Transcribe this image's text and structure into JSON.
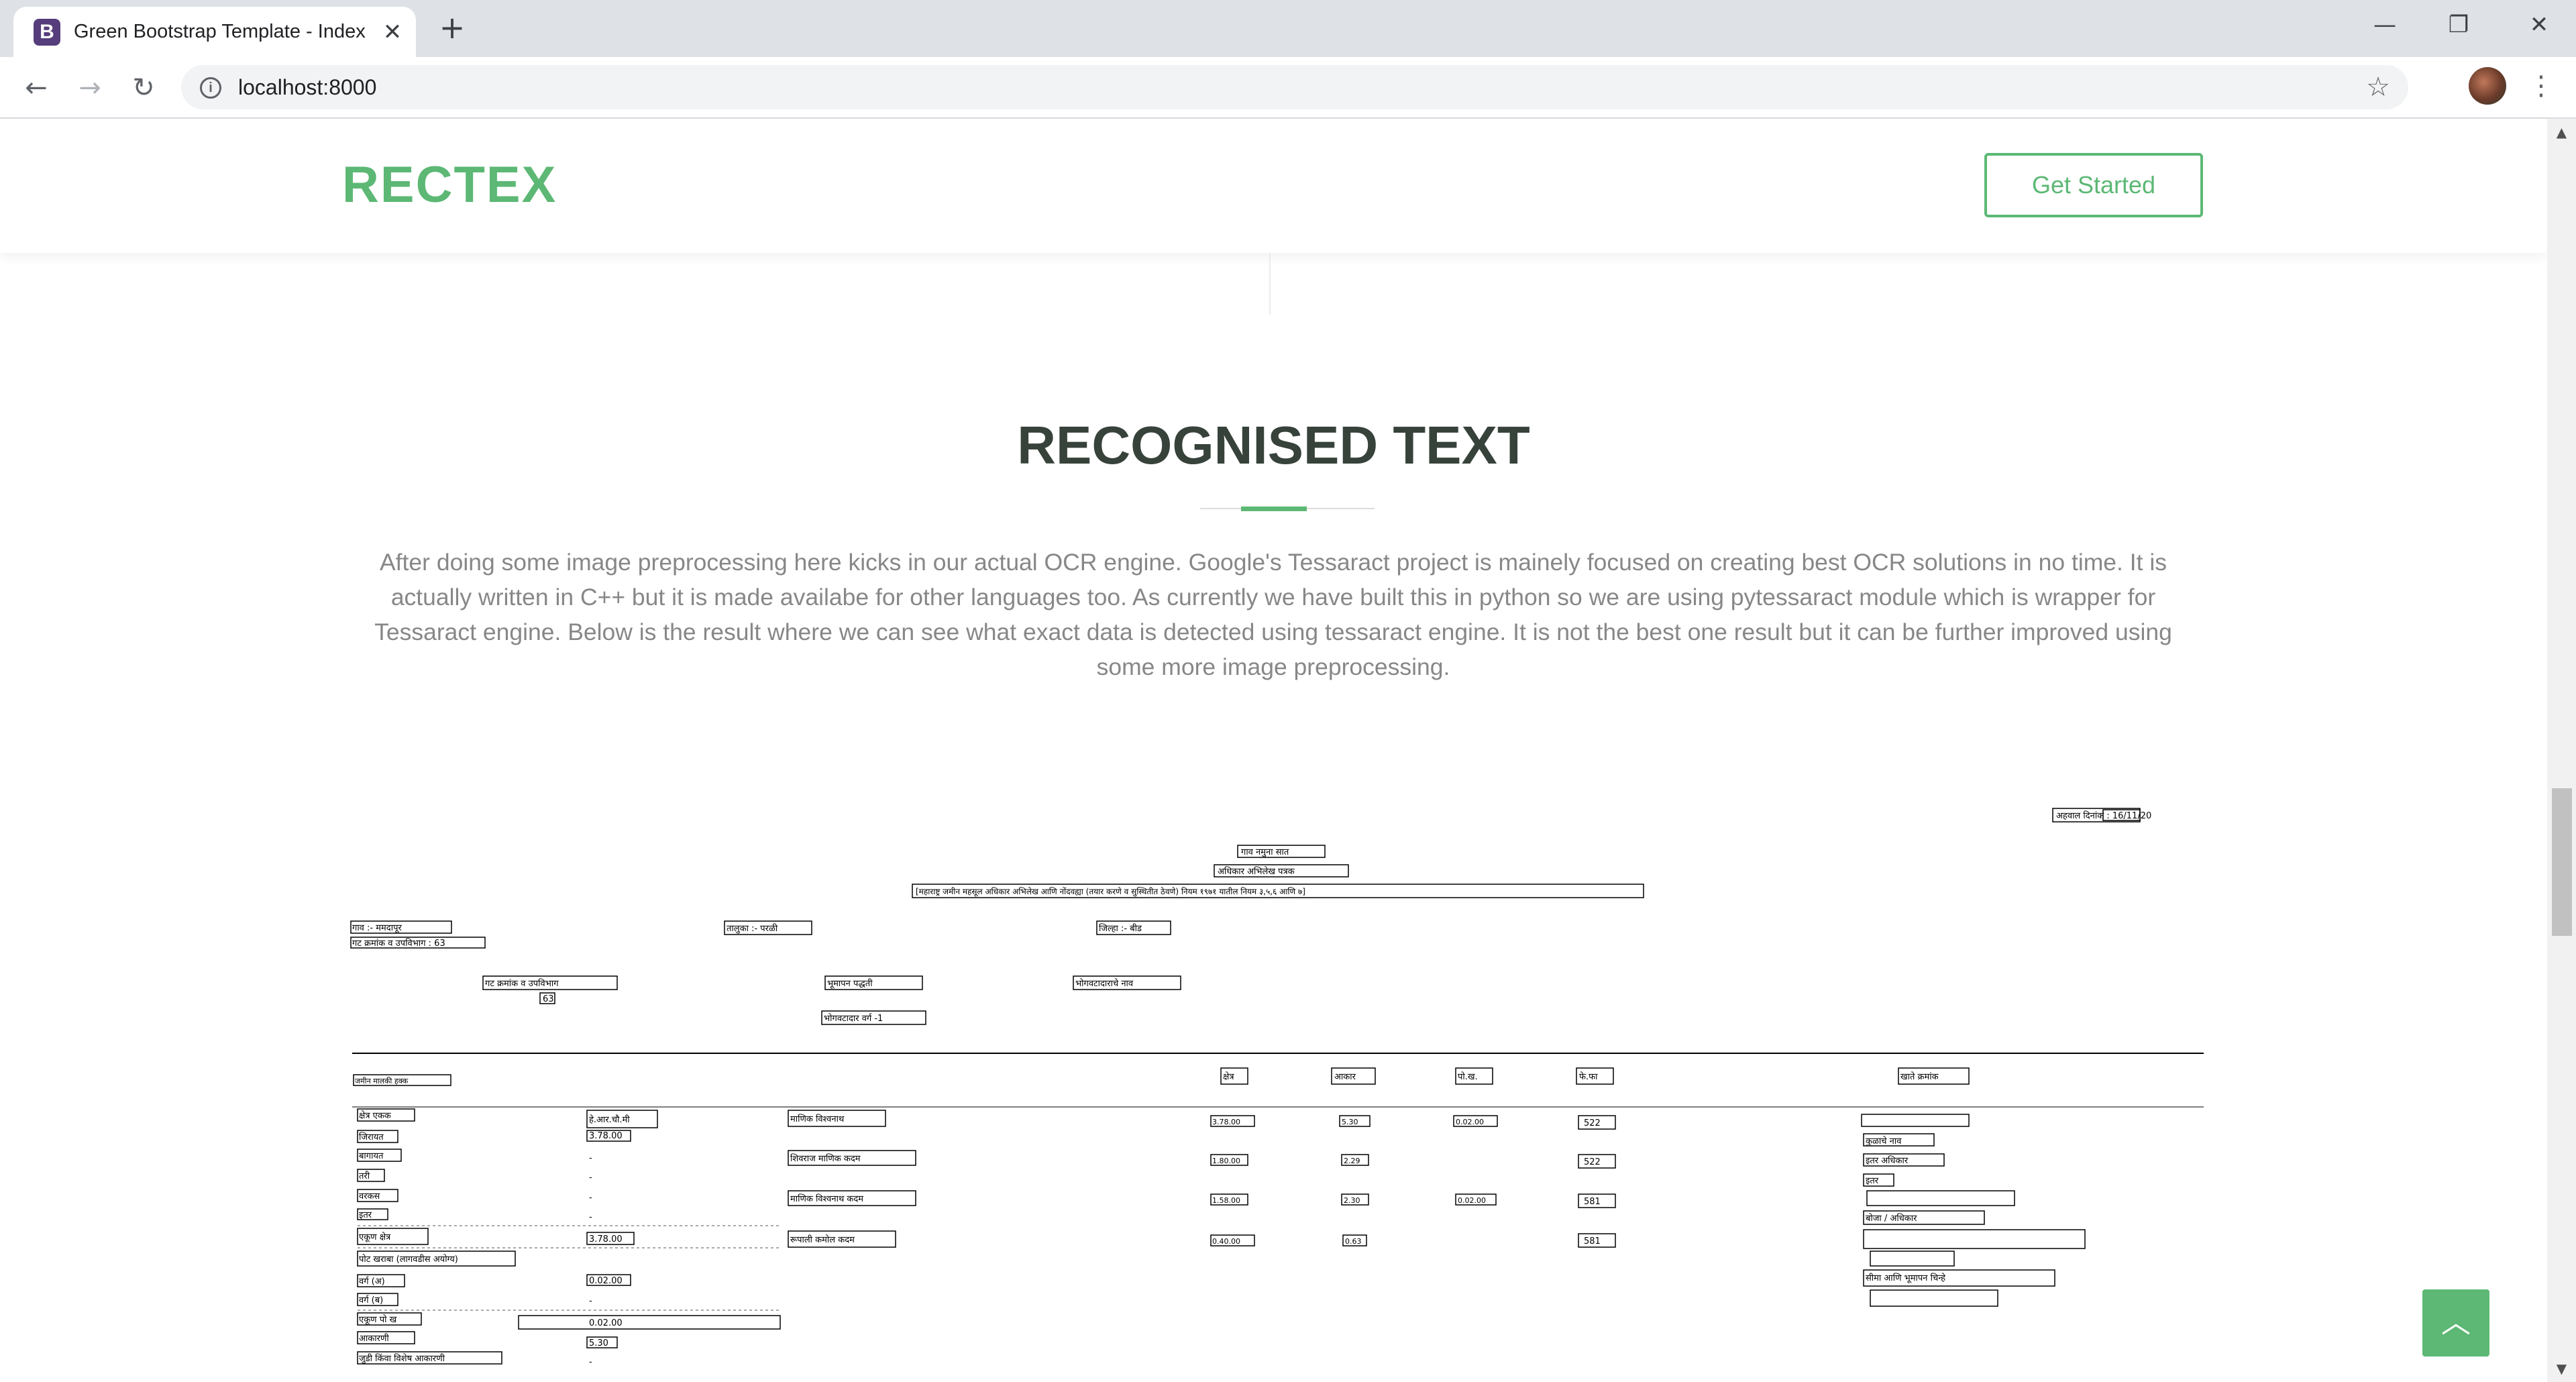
{
  "browser": {
    "tab_favicon": "B",
    "tab_title": "Green Bootstrap Template - Index",
    "tab_close": "✕",
    "new_tab": "+",
    "url": "localhost:8000",
    "icons": {
      "back": "back-arrow-icon",
      "forward": "forward-arrow-icon",
      "reload": "reload-icon",
      "info": "info-icon",
      "star": "star-icon",
      "menu": "kebab-menu-icon"
    }
  },
  "window_controls": {
    "minimize": "—",
    "restore": "❐",
    "close": "✕"
  },
  "header": {
    "logo": "RECTEX",
    "cta_label": "Get Started"
  },
  "section": {
    "title": "RECOGNISED TEXT",
    "description": "After doing some image preprocessing here kicks in our actual OCR engine. Google's Tessaract project is mainely focused on creating best OCR solutions in no time. It is actually written in C++ but it is made availabe for other languages too. As currently we have built this in python so we are using pytessaract module which is wrapper for Tessaract engine. Below is the result where we can see what exact data is detected using tessaract engine. It is not the best one result but it can be further improved using some more image preprocessing."
  },
  "ocr_result": {
    "top_right": "अहवाल दिनांक : 16/11/20",
    "heading_lines": [
      "गाव नमुना सात",
      "अधिकार अभिलेख पत्रक",
      "[महाराष्ट्र जमीन महसूल अधिकार अभिलेख आणि नोंदवह्या (तयार करणे व सुस्थितीत ठेवणे) नियम १९७१ यातील नियम ३,५,६ आणि ७]"
    ],
    "meta": [
      "गाव :- ममदापूर",
      "गट क्रमांक व उपविभाग : 63",
      "तालुका :- परळी",
      "जिल्हा :- बीड",
      "भूमापन पद्धती",
      "भोगवटादाराचे नाव",
      "भोगवटादार वर्ग -1"
    ],
    "column_headers": [
      "क्षेत्र",
      "आकार",
      "पो.ख.",
      "फे.फा",
      "खाते क्रमांक"
    ],
    "left_labels": [
      "क्षेत्र एकक",
      "जिरायत",
      "बागायत",
      "तरी",
      "वरकस",
      "इतर",
      "एकूण क्षेत्र",
      "पोट खराब",
      "वर्ग (अ)",
      "वर्ग (ब)",
      "एकूण पो ख",
      "आकारणी",
      "जुडी किंवा विशेष आकारणी"
    ],
    "left_values": [
      "हे.आर.चौ.मी",
      "3.78.00",
      "-",
      "-",
      "-",
      "-",
      "3.78.00",
      "0.02.00",
      "-",
      "0.02.00",
      "5.30",
      "-"
    ],
    "owners": [
      "माणिक विश्वनाथ",
      "शिवराज माणिक कदम",
      "माणिक विश्वनाथ कदम",
      "रूपाली कमोल कदम"
    ],
    "areas": [
      "3.78.00",
      "1.80.00",
      "1.58.00",
      "0.40.00"
    ],
    "akar": [
      "5.30",
      "2.29",
      "2.30",
      "0.63"
    ],
    "pokh": [
      "0.02.00",
      "0.02.00"
    ],
    "fefa": [
      "522",
      "522",
      "581",
      "581"
    ],
    "right_notes": [
      "कुळाचे नाव",
      "इतर अधिकार",
      "इतर",
      "बोजा / अधिकार",
      "सीमा आणि भूमापन चिन्हे"
    ]
  }
}
